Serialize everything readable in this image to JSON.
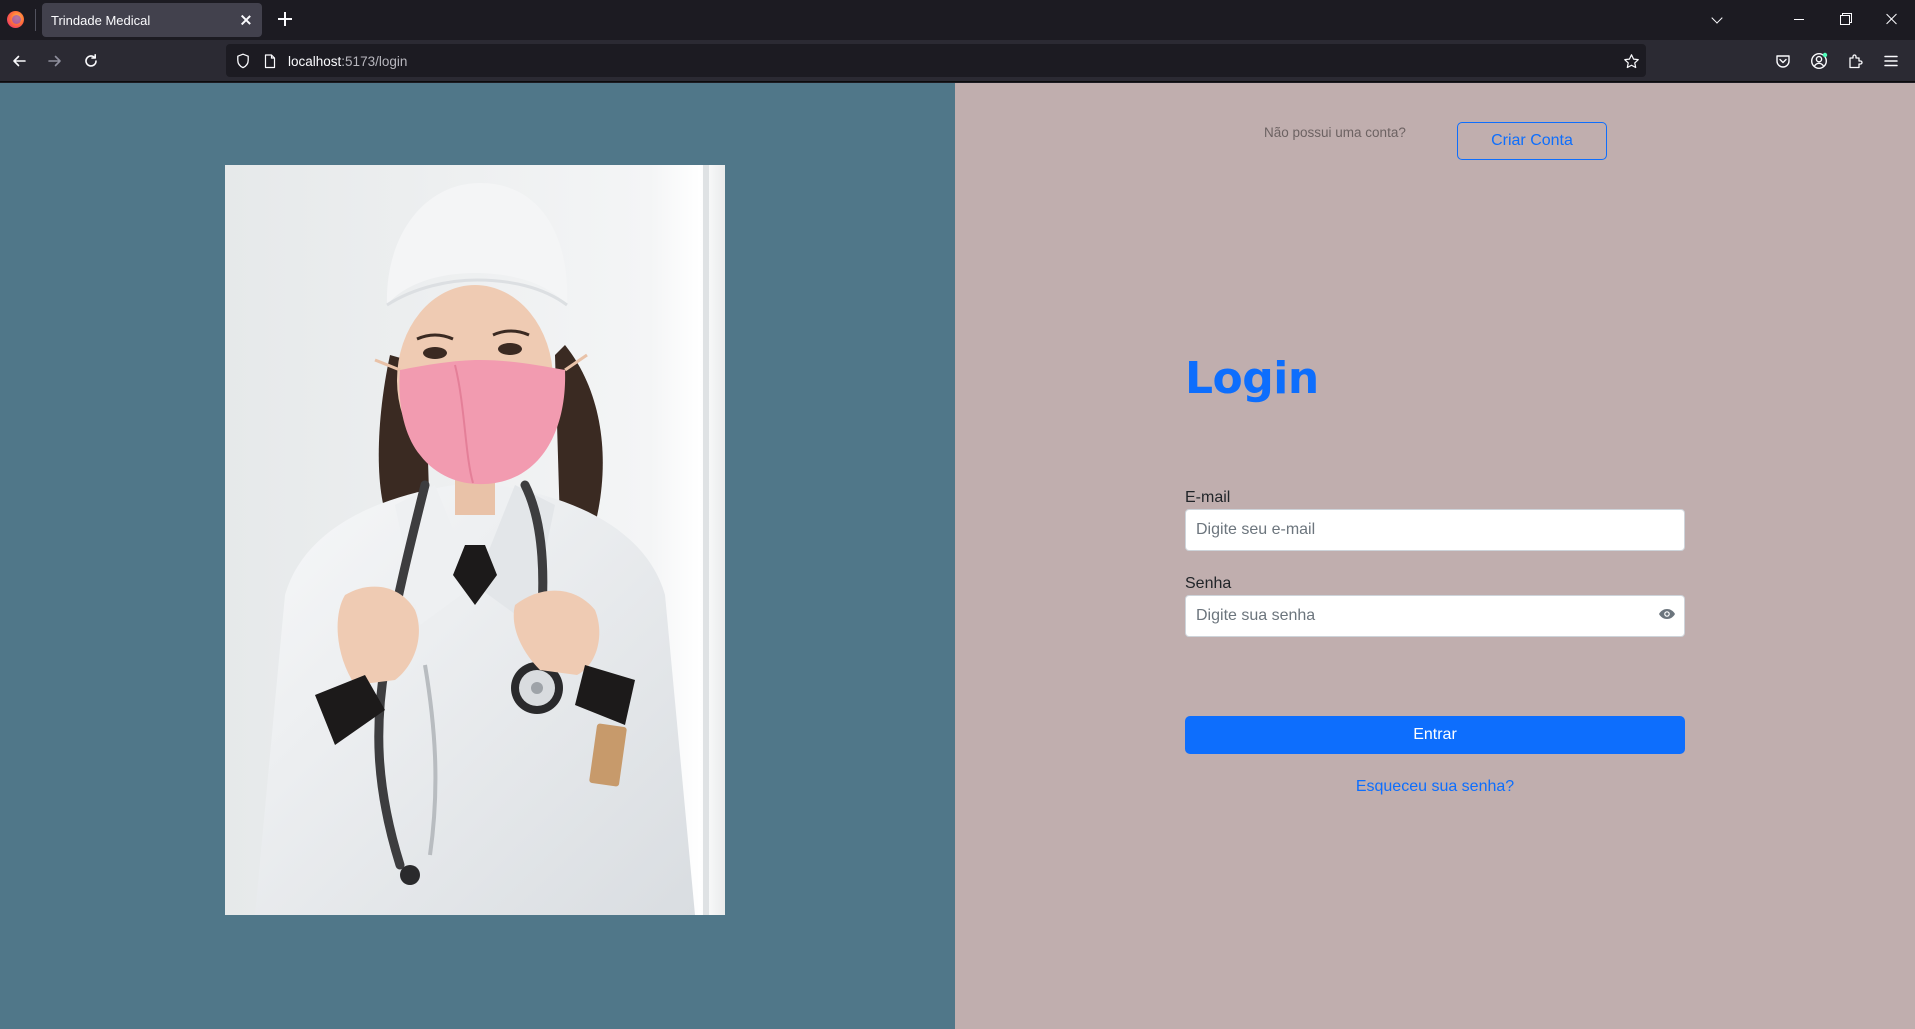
{
  "browser": {
    "tab_title": "Trindade Medical",
    "url_host": "localhost",
    "url_path": ":5173/login"
  },
  "auth": {
    "signup_question": "Não possui uma conta?",
    "signup_button": "Criar Conta",
    "title": "Login",
    "email_label": "E-mail",
    "email_placeholder": "Digite seu e-mail",
    "password_label": "Senha",
    "password_placeholder": "Digite sua senha",
    "submit_button": "Entrar",
    "forgot_link": "Esqueceu sua senha?"
  },
  "colors": {
    "left_panel": "#507789",
    "right_panel": "#c0aeae",
    "primary": "#0d6efd"
  }
}
